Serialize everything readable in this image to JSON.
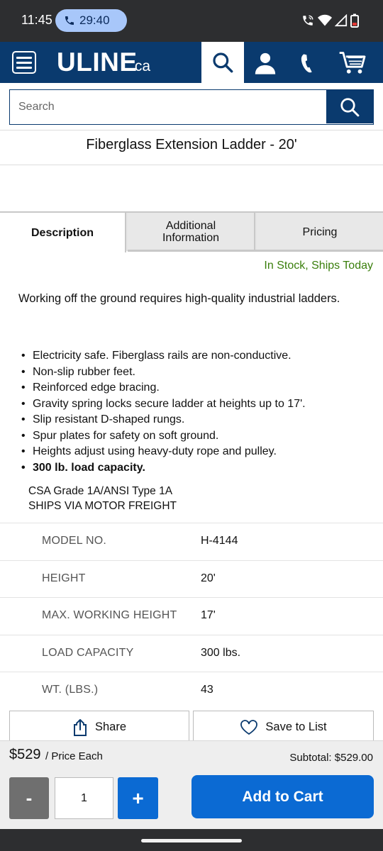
{
  "status_bar": {
    "time": "11:45",
    "call_timer": "29:40",
    "icons": [
      "wifi-calling-icon",
      "wifi-icon",
      "signal-icon",
      "battery-icon"
    ]
  },
  "header": {
    "logo_text": "ULINE",
    "logo_suffix": ".ca",
    "brand_color": "#0a3a6e",
    "icons": [
      "menu-icon",
      "search-icon",
      "user-icon",
      "phone-icon",
      "cart-icon"
    ]
  },
  "search": {
    "placeholder": "Search"
  },
  "product": {
    "title": "Fiberglass Extension Ladder - 20'"
  },
  "tabs": [
    {
      "label": "Description",
      "active": true
    },
    {
      "label": "Additional Information",
      "active": false
    },
    {
      "label": "Pricing",
      "active": false
    }
  ],
  "stock_status": "In Stock, Ships Today",
  "description": {
    "intro": "Working off the ground requires high-quality industrial ladders.",
    "bullets": [
      "Electricity safe. Fiberglass rails are non-conductive.",
      "Non-slip rubber feet.",
      "Reinforced edge bracing.",
      "Gravity spring locks secure ladder at heights up to 17'.",
      "Slip resistant D-shaped rungs.",
      "Spur plates for safety on soft ground.",
      "Heights adjust using heavy-duty rope and pulley.",
      "300 lb. load capacity."
    ],
    "cert_line_1": "CSA Grade 1A/ANSI Type 1A",
    "cert_line_2": "SHIPS VIA MOTOR FREIGHT"
  },
  "specs": [
    {
      "label": "MODEL NO.",
      "value": "H-4144"
    },
    {
      "label": "HEIGHT",
      "value": "20'"
    },
    {
      "label": "MAX. WORKING HEIGHT",
      "value": "17'"
    },
    {
      "label": "LOAD CAPACITY",
      "value": "300 lbs."
    },
    {
      "label": "WT. (LBS.)",
      "value": "43"
    }
  ],
  "actions": {
    "share_label": "Share",
    "save_label": "Save to List"
  },
  "purchase": {
    "price": "$529",
    "price_unit": "/ Price Each",
    "subtotal": "Subtotal: $529.00",
    "minus_label": "-",
    "quantity": "1",
    "plus_label": "+",
    "add_to_cart_label": "Add to Cart",
    "accent_color": "#0b6ad3"
  }
}
